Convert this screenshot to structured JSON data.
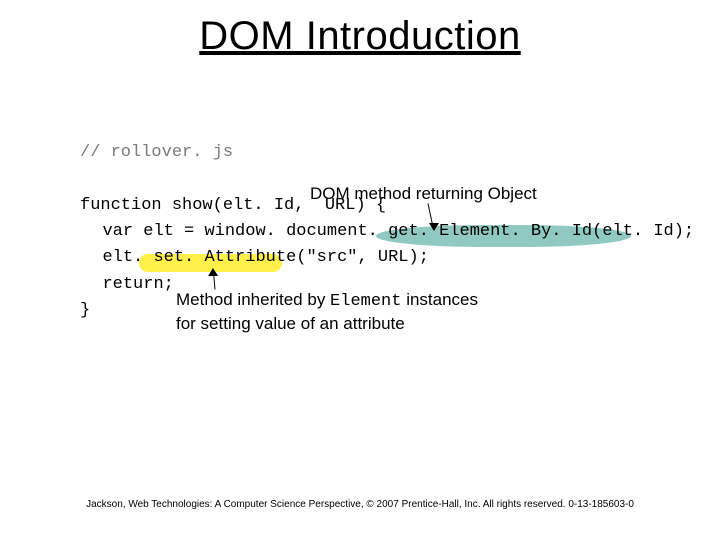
{
  "title": "DOM Introduction",
  "code": {
    "comment": "// rollover. js",
    "fn_open": "function show(elt. Id,  URL) {",
    "line_var": "var elt = window. document. get. Element. By. Id(elt. Id);",
    "line_set": "elt. set. Attribute(\"src\", URL);",
    "line_ret": "return;",
    "fn_close": "}"
  },
  "annot_top": "DOM method returning Object",
  "annot_bottom_l1_pre": "Method inherited by ",
  "annot_bottom_l1_mono": "Element",
  "annot_bottom_l1_post": " instances",
  "annot_bottom_l2": "for setting value of an attribute",
  "footer": "Jackson, Web Technologies: A Computer Science Perspective, © 2007 Prentice-Hall, Inc. All rights reserved. 0-13-185603-0"
}
